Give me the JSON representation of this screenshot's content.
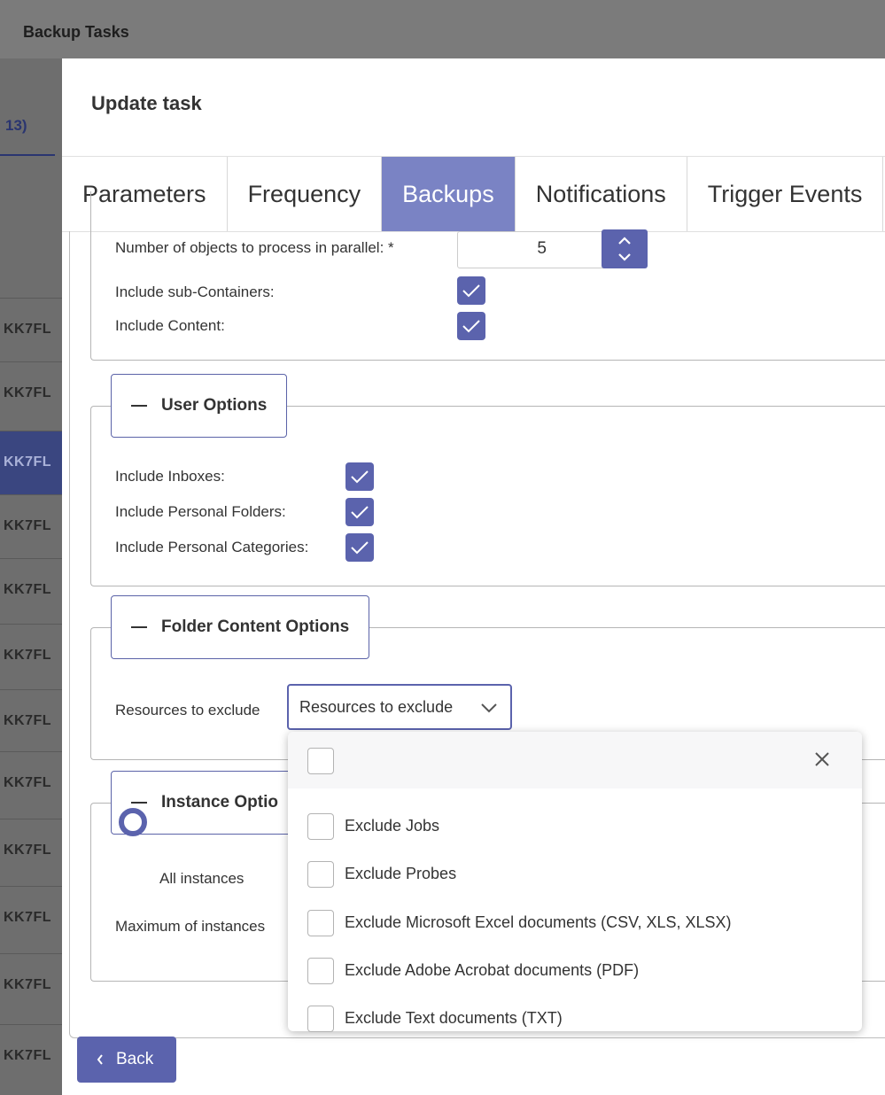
{
  "background": {
    "title": "Backup Tasks",
    "tab_fragment": "13)",
    "row_label": "KK7FL",
    "rows_count": 11
  },
  "modal": {
    "title": "Update task",
    "tabs": [
      {
        "label": "Parameters",
        "active": false
      },
      {
        "label": "Frequency",
        "active": false
      },
      {
        "label": "Backups",
        "active": true
      },
      {
        "label": "Notifications",
        "active": false
      },
      {
        "label": "Trigger Events",
        "active": false
      }
    ]
  },
  "general": {
    "parallel_label": "Number of objects to process in parallel: *",
    "parallel_value": "5",
    "subcontainers_label": "Include sub-Containers:",
    "subcontainers_checked": true,
    "content_label": "Include Content:",
    "content_checked": true
  },
  "user_options": {
    "legend": "User Options",
    "inboxes_label": "Include Inboxes:",
    "inboxes_checked": true,
    "personal_folders_label": "Include Personal Folders:",
    "personal_folders_checked": true,
    "personal_categories_label": "Include Personal Categories:",
    "personal_categories_checked": true
  },
  "folder_content_options": {
    "legend": "Folder Content Options",
    "resources_label": "Resources to exclude",
    "resources_placeholder": "Resources to exclude"
  },
  "instance_options": {
    "legend": "Instance Optio",
    "all_instances_label": "All instances",
    "max_instances_label": "Maximum of instances"
  },
  "dropdown": {
    "options": [
      {
        "label": "Exclude Jobs",
        "checked": false
      },
      {
        "label": "Exclude Probes",
        "checked": false
      },
      {
        "label": "Exclude Microsoft Excel documents (CSV, XLS, XLSX)",
        "checked": false
      },
      {
        "label": "Exclude Adobe Acrobat documents (PDF)",
        "checked": false
      },
      {
        "label": "Exclude Text documents (TXT)",
        "checked": false
      }
    ]
  },
  "footer": {
    "back_label": "Back"
  },
  "colors": {
    "accent": "#5b63ad",
    "active_tab": "#7a83c4"
  }
}
